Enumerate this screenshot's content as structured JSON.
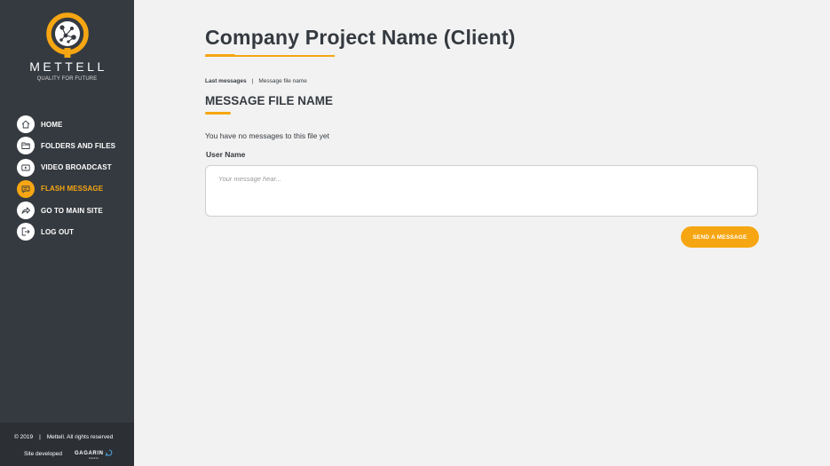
{
  "sidebar": {
    "brand": "METTELL",
    "tagline": "QUALITY FOR FUTURE",
    "items": [
      {
        "label": "HOME",
        "icon": "home-icon",
        "active": false
      },
      {
        "label": "FOLDERS AND FILES",
        "icon": "folder-icon",
        "active": false
      },
      {
        "label": "VIDEO BROADCAST",
        "icon": "video-icon",
        "active": false
      },
      {
        "label": "FLASH MESSAGE",
        "icon": "message-icon",
        "active": true
      },
      {
        "label": "GO TO MAIN SITE",
        "icon": "share-arrow-icon",
        "active": false
      },
      {
        "label": "LOG OUT",
        "icon": "logout-icon",
        "active": false
      }
    ],
    "footer": {
      "copyright_year": "© 2019",
      "copyright_sep": "|",
      "copyright_text": "Mettell. All rights reserved",
      "developed": "Site developed",
      "studio_name": "GAGARIN",
      "studio_sub": "studio"
    }
  },
  "main": {
    "title": "Company Project Name (Client)",
    "breadcrumb": {
      "link": "Last messages",
      "separator": "|",
      "current": "Message file name"
    },
    "section_title": "MESSAGE FILE NAME",
    "empty_text": "You have no messages to this file yet",
    "user_name": "User Name",
    "message_placeholder": "Your message hear...",
    "send_label": "SEND A MESSAGE"
  },
  "colors": {
    "accent": "#f6a612",
    "sidebar_bg": "#353a40",
    "footer_bg": "#2c3035",
    "page_bg": "#f2f2f2",
    "text": "#353a40"
  }
}
